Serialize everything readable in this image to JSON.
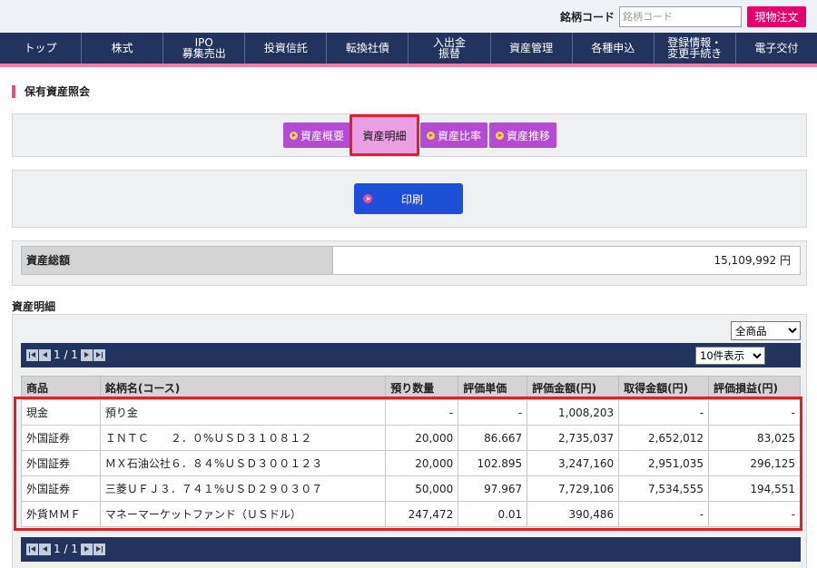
{
  "header": {
    "code_label": "銘柄コード",
    "code_placeholder": "銘柄コード",
    "order_button": "現物注文"
  },
  "nav": [
    "トップ",
    "株式",
    "IPO\n募集売出",
    "投資信託",
    "転換社債",
    "入出金\n振替",
    "資産管理",
    "各種申込",
    "登録情報・\n変更手続き",
    "電子交付"
  ],
  "page_title": "保有資産照会",
  "tabs": [
    {
      "label": "資産概要",
      "active": false
    },
    {
      "label": "資産明細",
      "active": true
    },
    {
      "label": "資産比率",
      "active": false
    },
    {
      "label": "資産推移",
      "active": false
    }
  ],
  "print_button": "印刷",
  "total": {
    "label": "資産総額",
    "value": "15,109,992 円"
  },
  "detail": {
    "heading": "資産明細",
    "filter_selected": "全商品",
    "per_page_selected": "10件表示",
    "pager_text": "1 / 1",
    "columns": [
      "商品",
      "銘柄名(コース)",
      "預り数量",
      "評価単価",
      "評価金額(円)",
      "取得金額(円)",
      "評価損益(円)"
    ],
    "rows": [
      [
        "現金",
        "預り金",
        "-",
        "-",
        "1,008,203",
        "-",
        "-"
      ],
      [
        "外国証券",
        "ＩＮＴＣ　　２．０%ＵＳＤ３１０８１２",
        "20,000",
        "86.667",
        "2,735,037",
        "2,652,012",
        "83,025"
      ],
      [
        "外国証券",
        "ＭＸ石油公社６．８４%ＵＳＤ３００１２３",
        "20,000",
        "102.895",
        "3,247,160",
        "2,951,035",
        "296,125"
      ],
      [
        "外国証券",
        "三菱ＵＦＪ３．７４１%ＵＳＤ２９０３０７",
        "50,000",
        "97.967",
        "7,729,106",
        "7,534,555",
        "194,551"
      ],
      [
        "外貨ＭＭＦ",
        "マネーマーケットファンド（ＵＳドル）",
        "247,472",
        "0.01",
        "390,486",
        "-",
        "-"
      ]
    ]
  },
  "colors": {
    "nav": "#22335e",
    "accent_pink": "#e6006e",
    "tab_purple": "#b44bd4",
    "highlight_red": "#e12027",
    "print_blue": "#1d4fd8"
  }
}
